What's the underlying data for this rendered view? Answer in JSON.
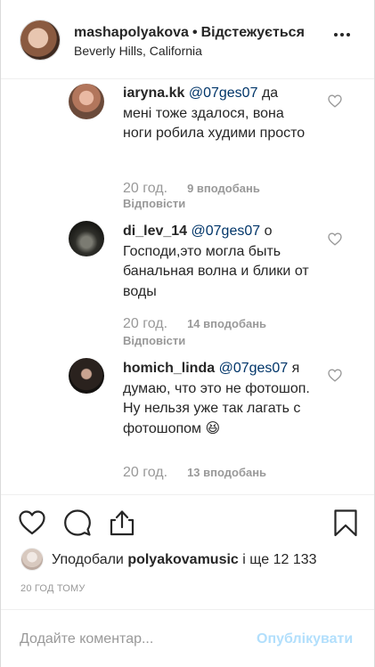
{
  "header": {
    "username": "mashapolyakova",
    "separator": "•",
    "follow_status": "Відстежується",
    "location": "Beverly Hills, California"
  },
  "comments": [
    {
      "username": "iaryna.kk",
      "mention": "@07ges07",
      "text": "да мені тоже здалося, вона ноги робила худими просто",
      "time": "20 год.",
      "likes": "9 вподобань",
      "reply_label": "Відповісти"
    },
    {
      "username": "di_lev_14",
      "mention": "@07ges07",
      "text": "о Господи,это могла быть банальная волна и блики от воды",
      "time": "20 год.",
      "likes": "14 вподобань",
      "reply_label": "Відповісти"
    },
    {
      "username": "homich_linda",
      "mention": "@07ges07",
      "text": "я думаю, что это не фотошоп. Ну нельзя уже так лагать с фотошопом 😆",
      "time": "20 год.",
      "likes": "13 вподобань"
    }
  ],
  "likes": {
    "prefix": "Уподобали",
    "user": "polyakovamusic",
    "suffix": "і ще 12 133"
  },
  "time_ago": "20 ГОД ТОМУ",
  "add_comment": {
    "placeholder": "Додайте коментар...",
    "post_label": "Опублікувати"
  },
  "icons": {
    "like": "heart-icon",
    "comment": "comment-icon",
    "share": "share-icon",
    "save": "bookmark-icon",
    "more": "more-dots-icon"
  },
  "colors": {
    "mention": "#003569",
    "muted": "#999999",
    "post_disabled": "#b2dffc"
  }
}
